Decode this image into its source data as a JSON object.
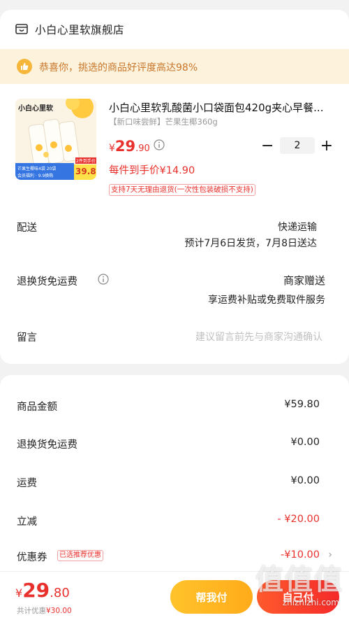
{
  "shop": {
    "name": "小白心里软旗舰店",
    "icon": "shop-icon"
  },
  "notice": {
    "icon": "thumbs-up-icon",
    "text": "恭喜你，挑选的商品好评度高达98%"
  },
  "product": {
    "image_brand": "小白心里软",
    "image_badge_top": "2件到手价",
    "image_badge_price": "39.8",
    "image_banner_line1": "芒果生椰味4袋 20袋",
    "image_banner_line2": "会员福利 · 9.9换购",
    "title": "小白心里软乳酸菌小口袋面包420g夹心早餐...",
    "variant": "【新口味尝鲜】芒果生椰360g",
    "price_symbol": "¥",
    "price_int": "29",
    "price_dec": ".90",
    "quantity": "2",
    "minus": "−",
    "plus": "+",
    "unit_price": "每件到手价¥14.90",
    "return_tag": "支持7天无理由退货(一次性包装破损不支持)"
  },
  "delivery": {
    "label": "配送",
    "method": "快递运输",
    "estimate": "预计7月6日发货，7月8日送达"
  },
  "return_shipping": {
    "label": "退换货免运费",
    "value": "商家赠送",
    "desc": "享运费补贴或免费取件服务"
  },
  "message": {
    "label": "留言",
    "placeholder": "建议留言前先与商家沟通确认"
  },
  "fees": {
    "goods": {
      "label": "商品金额",
      "value": "¥59.80"
    },
    "return_free": {
      "label": "退换货免运费",
      "value": "¥0.00"
    },
    "shipping": {
      "label": "运费",
      "value": "¥0.00"
    },
    "discount": {
      "label": "立减",
      "value": "- ¥20.00"
    },
    "coupon": {
      "label": "优惠券",
      "tag": "已选推荐优惠",
      "value": "-¥10.00"
    }
  },
  "footer": {
    "total_symbol": "¥",
    "total_int": "29",
    "total_dec": ".80",
    "saved_prefix": "共计优惠",
    "saved_amount": "¥30.00",
    "help_pay": "帮我付",
    "self_pay": "自己付"
  },
  "watermark": {
    "logo": "值值值",
    "url": "zhizhizhi.com"
  },
  "colors": {
    "accent": "#e8302c",
    "notice_bg": "#fdf2dc",
    "notice_text": "#c8762a",
    "help_button": "#ffb41f",
    "pay_button": "#f52a2a"
  }
}
